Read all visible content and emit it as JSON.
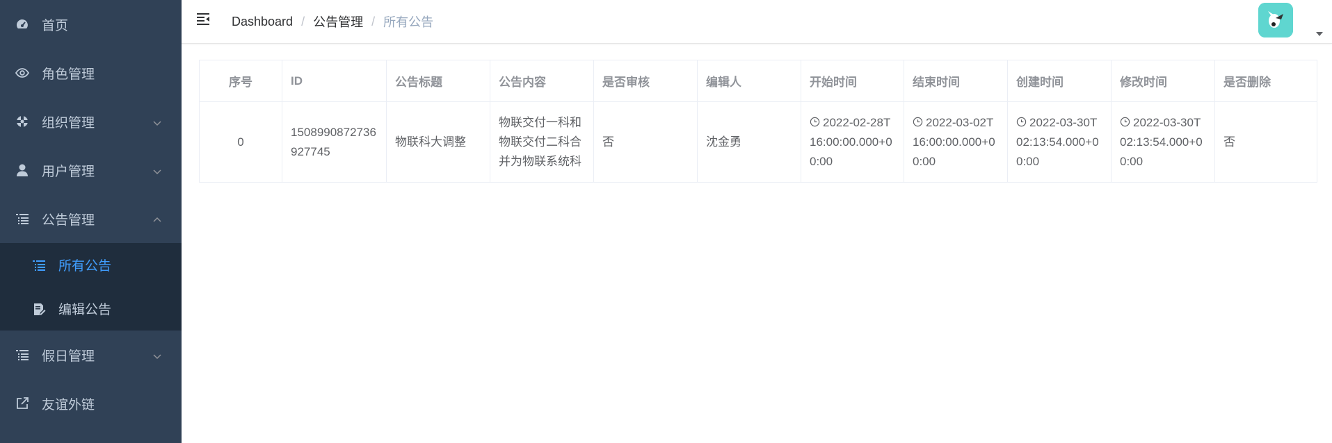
{
  "sidebar": {
    "items": [
      {
        "label": "首页",
        "icon": "dashboard-icon"
      },
      {
        "label": "角色管理",
        "icon": "eye-icon"
      },
      {
        "label": "组织管理",
        "icon": "component-icon"
      },
      {
        "label": "用户管理",
        "icon": "user-icon"
      },
      {
        "label": "公告管理",
        "icon": "list-icon"
      },
      {
        "label": "假日管理",
        "icon": "list-icon"
      },
      {
        "label": "友谊外链",
        "icon": "external-link-icon"
      }
    ],
    "submenu": [
      {
        "label": "所有公告",
        "icon": "list-icon",
        "active": true
      },
      {
        "label": "编辑公告",
        "icon": "edit-icon",
        "active": false
      }
    ]
  },
  "breadcrumb": [
    "Dashboard",
    "公告管理",
    "所有公告"
  ],
  "table": {
    "headers": [
      "序号",
      "ID",
      "公告标题",
      "公告内容",
      "是否审核",
      "编辑人",
      "开始时间",
      "结束时间",
      "创建时间",
      "修改时间",
      "是否删除"
    ],
    "row": {
      "index": "0",
      "id": "1508990872736927745",
      "title": "物联科大调整",
      "content": "物联交付一科和物联交付二科合并为物联系统科",
      "audited": "否",
      "editor": "沈金勇",
      "start_time": "2022-02-28T16:00:00.000+00:00",
      "end_time": "2022-03-02T16:00:00.000+00:00",
      "created_time": "2022-03-30T02:13:54.000+00:00",
      "modified_time": "2022-03-30T02:13:54.000+00:00",
      "deleted": "否"
    }
  },
  "colors": {
    "sidebar_bg": "#304156",
    "submenu_bg": "#1f2d3d",
    "sidebar_text": "#bfcbd9",
    "active": "#409eff",
    "avatar_bg": "#5fd6d0"
  }
}
